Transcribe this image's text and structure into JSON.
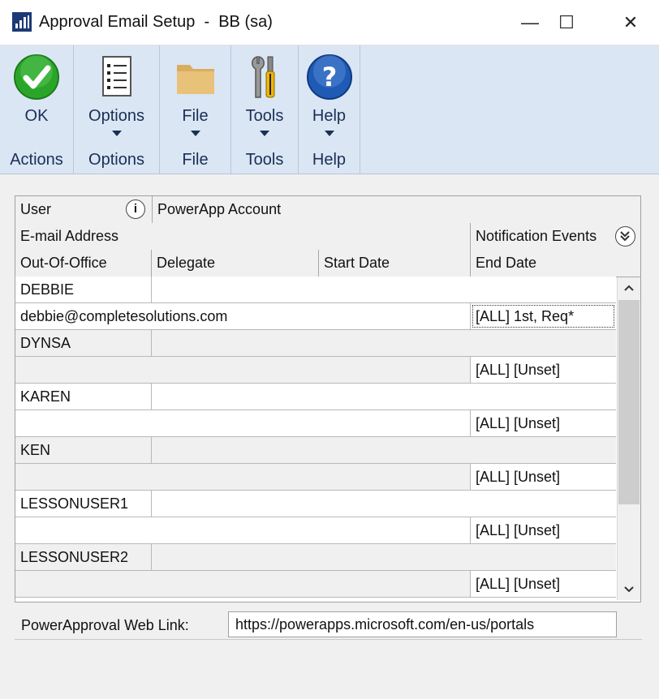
{
  "window": {
    "title": "Approval Email Setup  -  BB (sa)",
    "minimize": "—",
    "maximize": "☐",
    "close": "✕"
  },
  "ribbon": {
    "groups": [
      {
        "button": "OK",
        "group": "Actions",
        "icon": "check-circle-icon"
      },
      {
        "button": "Options",
        "group": "Options",
        "icon": "list-document-icon"
      },
      {
        "button": "File",
        "group": "File",
        "icon": "folder-icon"
      },
      {
        "button": "Tools",
        "group": "Tools",
        "icon": "tools-icon"
      },
      {
        "button": "Help",
        "group": "Help",
        "icon": "help-icon"
      }
    ]
  },
  "grid": {
    "header1": {
      "user": "User",
      "account": "PowerApp Account"
    },
    "header2": {
      "email": "E-mail Address",
      "events": "Notification Events"
    },
    "header3": {
      "ooo": "Out-Of-Office",
      "delegate": "Delegate",
      "start": "Start Date",
      "end": "End Date"
    },
    "records": [
      {
        "user": "DEBBIE",
        "email": "debbie@completesolutions.com",
        "events": "[ALL] 1st, Req*"
      },
      {
        "user": "DYNSA",
        "email": "",
        "events": "[ALL] [Unset]"
      },
      {
        "user": "KAREN",
        "email": "",
        "events": "[ALL] [Unset]"
      },
      {
        "user": "KEN",
        "email": "",
        "events": "[ALL] [Unset]"
      },
      {
        "user": "LESSONUSER1",
        "email": "",
        "events": "[ALL] [Unset]"
      },
      {
        "user": "LESSONUSER2",
        "email": "",
        "events": "[ALL] [Unset]"
      }
    ]
  },
  "weblink": {
    "label": "PowerApproval Web Link:",
    "value": "https://powerapps.microsoft.com/en-us/portals"
  },
  "colors": {
    "ribbon": "#dbe6f4",
    "ok_green": "#2aa52a",
    "help_blue": "#1f5bb5",
    "title_icon": "#1b3a75"
  }
}
